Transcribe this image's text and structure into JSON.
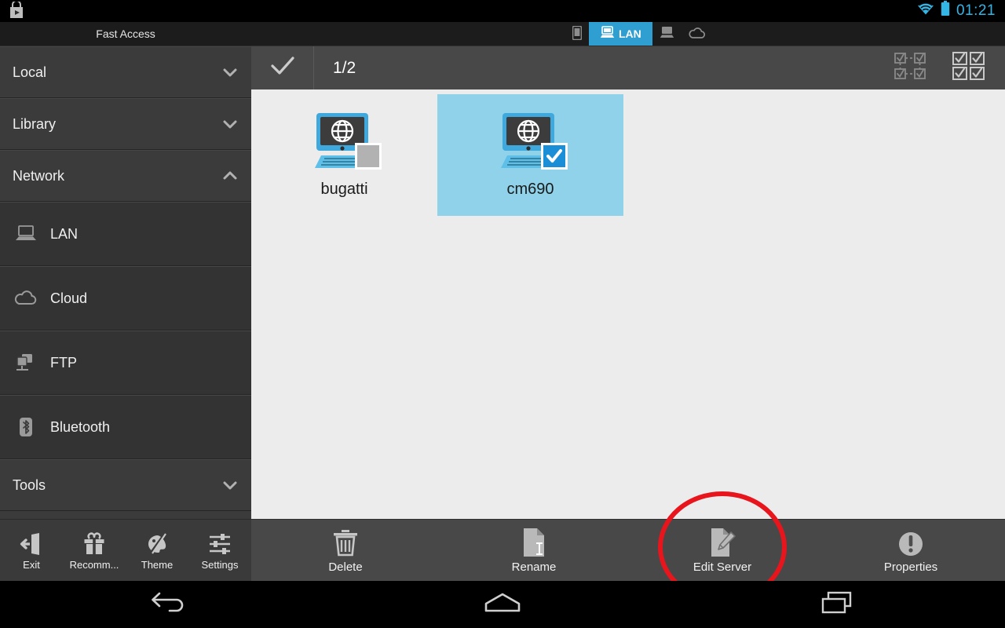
{
  "status_bar": {
    "notification_icon": "play-store-icon",
    "wifi_icon": "wifi-icon",
    "battery_icon": "battery-icon",
    "time": "01:21",
    "accent_color": "#33b5e5"
  },
  "app": {
    "title": "Fast Access",
    "tabs": [
      {
        "label": "",
        "icon": "phone-icon",
        "active": false
      },
      {
        "label": "LAN",
        "icon": "lan-computer-icon",
        "active": true
      },
      {
        "label": "",
        "icon": "computer-icon",
        "active": false
      },
      {
        "label": "",
        "icon": "cloud-icon",
        "active": false
      }
    ],
    "active_tab_color": "#2e9fd0"
  },
  "sidebar": {
    "items": [
      {
        "label": "Local",
        "type": "group",
        "icon": "",
        "chevron": "chevron-down-icon"
      },
      {
        "label": "Library",
        "type": "group",
        "icon": "",
        "chevron": "chevron-down-icon"
      },
      {
        "label": "Network",
        "type": "group",
        "icon": "",
        "chevron": "chevron-up-icon"
      },
      {
        "label": "LAN",
        "type": "child",
        "icon": "laptop-icon",
        "chevron": ""
      },
      {
        "label": "Cloud",
        "type": "child",
        "icon": "cloud-icon",
        "chevron": ""
      },
      {
        "label": "FTP",
        "type": "child",
        "icon": "server-icon",
        "chevron": ""
      },
      {
        "label": "Bluetooth",
        "type": "child",
        "icon": "bluetooth-icon",
        "chevron": ""
      },
      {
        "label": "Tools",
        "type": "group",
        "icon": "",
        "chevron": "chevron-down-icon"
      }
    ]
  },
  "tools_bar": {
    "buttons": [
      {
        "label": "Exit",
        "icon": "exit-icon"
      },
      {
        "label": "Recomm...",
        "icon": "gift-icon"
      },
      {
        "label": "Theme",
        "icon": "palette-icon"
      },
      {
        "label": "Settings",
        "icon": "sliders-icon"
      }
    ]
  },
  "content_toolbar": {
    "confirm_icon": "checkmark-icon",
    "selection_count": "1/2",
    "select_inverse_icon": "select-inverse-icon",
    "select_all_icon": "select-all-icon"
  },
  "content": {
    "background_color": "#ececec",
    "selection_color": "#8fd2e9",
    "items": [
      {
        "name": "bugatti",
        "icon": "network-computer-icon",
        "selected": false,
        "checkbox": "checkbox-unchecked-icon"
      },
      {
        "name": "cm690",
        "icon": "network-computer-icon",
        "selected": true,
        "checkbox": "checkbox-checked-icon"
      }
    ]
  },
  "action_bar": {
    "buttons": [
      {
        "label": "Delete",
        "icon": "trash-icon"
      },
      {
        "label": "Rename",
        "icon": "document-rename-icon"
      },
      {
        "label": "Edit Server",
        "icon": "document-edit-icon"
      },
      {
        "label": "Properties",
        "icon": "info-exclamation-icon"
      }
    ]
  },
  "annotation": {
    "shape": "red-ellipse-highlight",
    "target_label": "Edit Server",
    "color": "#e8151d"
  },
  "nav_bar": {
    "buttons": [
      {
        "label": "Back",
        "icon": "back-arrow-icon"
      },
      {
        "label": "Home",
        "icon": "home-icon"
      },
      {
        "label": "Recents",
        "icon": "recents-icon"
      }
    ]
  }
}
